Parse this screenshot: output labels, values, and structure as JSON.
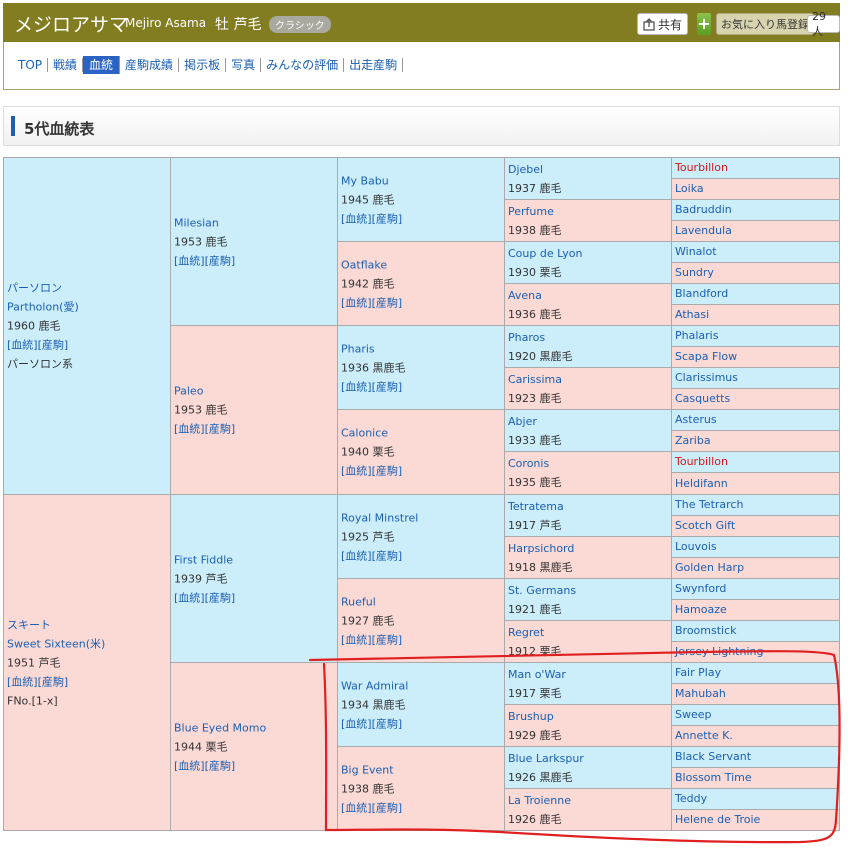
{
  "header": {
    "horse_name": "メジロアサマ",
    "romaji": "Mejiro Asama",
    "sex_color": "牡 芦毛",
    "badge": "クラシック",
    "share_label": "共有",
    "plus_label": "+",
    "fav_label": "お気に入り馬登録",
    "fav_count": "29人"
  },
  "nav": {
    "tabs": [
      "TOP",
      "戦績",
      "血統",
      "産駒成績",
      "掲示板",
      "写真",
      "みんなの評価",
      "出走産駒"
    ],
    "active": "血統"
  },
  "section": {
    "title": "5代血統表"
  },
  "links": {
    "pedigree": "[血統]",
    "progeny": "[産駒]"
  },
  "pedigree": {
    "g1": [
      {
        "name": "パーソロン",
        "name_en": "Partholon(愛)",
        "year": "1960 鹿毛",
        "line": "パーソロン系"
      },
      {
        "name": "スキート",
        "name_en": "Sweet Sixteen(米)",
        "year": "1951 芦毛",
        "line": "FNo.[1-x]"
      }
    ],
    "g2": [
      {
        "name": "Milesian",
        "year": "1953 鹿毛"
      },
      {
        "name": "Paleo",
        "year": "1953 鹿毛"
      },
      {
        "name": "First Fiddle",
        "year": "1939 芦毛"
      },
      {
        "name": "Blue Eyed Momo",
        "year": "1944 栗毛"
      }
    ],
    "g3": [
      {
        "name": "My Babu",
        "year": "1945 鹿毛"
      },
      {
        "name": "Oatflake",
        "year": "1942 鹿毛"
      },
      {
        "name": "Pharis",
        "year": "1936 黒鹿毛"
      },
      {
        "name": "Calonice",
        "year": "1940 栗毛"
      },
      {
        "name": "Royal Minstrel",
        "year": "1925 芦毛"
      },
      {
        "name": "Rueful",
        "year": "1927 鹿毛"
      },
      {
        "name": "War Admiral",
        "year": "1934 黒鹿毛"
      },
      {
        "name": "Big Event",
        "year": "1938 鹿毛"
      }
    ],
    "g4": [
      {
        "name": "Djebel",
        "year": "1937 鹿毛"
      },
      {
        "name": "Perfume",
        "year": "1938 鹿毛"
      },
      {
        "name": "Coup de Lyon",
        "year": "1930 栗毛"
      },
      {
        "name": "Avena",
        "year": "1936 鹿毛"
      },
      {
        "name": "Pharos",
        "year": "1920 黒鹿毛"
      },
      {
        "name": "Carissima",
        "year": "1923 鹿毛"
      },
      {
        "name": "Abjer",
        "year": "1933 鹿毛"
      },
      {
        "name": "Coronis",
        "year": "1935 鹿毛"
      },
      {
        "name": "Tetratema",
        "year": "1917 芦毛"
      },
      {
        "name": "Harpsichord",
        "year": "1918 黒鹿毛"
      },
      {
        "name": "St. Germans",
        "year": "1921 鹿毛"
      },
      {
        "name": "Regret",
        "year": "1912 栗毛"
      },
      {
        "name": "Man o'War",
        "year": "1917 栗毛"
      },
      {
        "name": "Brushup",
        "year": "1929 鹿毛"
      },
      {
        "name": "Blue Larkspur",
        "year": "1926 黒鹿毛"
      },
      {
        "name": "La Troienne",
        "year": "1926 鹿毛"
      }
    ],
    "g5": [
      {
        "name": "Tourbillon",
        "red": true
      },
      {
        "name": "Loika"
      },
      {
        "name": "Badruddin"
      },
      {
        "name": "Lavendula"
      },
      {
        "name": "Winalot"
      },
      {
        "name": "Sundry"
      },
      {
        "name": "Blandford"
      },
      {
        "name": "Athasi"
      },
      {
        "name": "Phalaris"
      },
      {
        "name": "Scapa Flow"
      },
      {
        "name": "Clarissimus"
      },
      {
        "name": "Casquetts"
      },
      {
        "name": "Asterus"
      },
      {
        "name": "Zariba"
      },
      {
        "name": "Tourbillon",
        "red": true
      },
      {
        "name": "Heldifann"
      },
      {
        "name": "The Tetrarch"
      },
      {
        "name": "Scotch Gift"
      },
      {
        "name": "Louvois"
      },
      {
        "name": "Golden Harp"
      },
      {
        "name": "Swynford"
      },
      {
        "name": "Hamoaze"
      },
      {
        "name": "Broomstick"
      },
      {
        "name": "Jersey Lightning"
      },
      {
        "name": "Fair Play"
      },
      {
        "name": "Mahubah"
      },
      {
        "name": "Sweep"
      },
      {
        "name": "Annette K."
      },
      {
        "name": "Black Servant"
      },
      {
        "name": "Blossom Time"
      },
      {
        "name": "Teddy"
      },
      {
        "name": "Helene de Troie"
      }
    ]
  },
  "colors": {
    "header_bg": "#837d22",
    "sire_bg": "#cceefa",
    "dam_bg": "#fbd9d5",
    "link": "#1a5fb4",
    "highlight_red": "#d81818",
    "annotation": "#e02020"
  }
}
